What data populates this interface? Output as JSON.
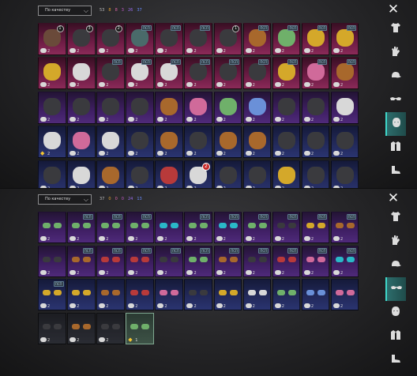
{
  "panels": [
    {
      "sort_label": "По качеству",
      "counts": [
        {
          "value": "53",
          "color": "#bdbdbd"
        },
        {
          "value": "8",
          "color": "#e0a030"
        },
        {
          "value": "8",
          "color": "#e066a8"
        },
        {
          "value": "3",
          "color": "#c45ac8"
        },
        {
          "value": "26",
          "color": "#9b6cf0"
        },
        {
          "value": "37",
          "color": "#6a8cff"
        }
      ],
      "active_tab": 4,
      "rows": [
        [
          "p:2:b:1:s",
          "p:2:b:3:d",
          "p:2:b:2:d",
          "p:2:t:ПСП:t",
          "p:2:t:ПСП:d",
          "p:2:t:ПСП:d",
          "p:2:b:1:d",
          "p:2:t:ПСП:o",
          "p:2:t:ПСП:g",
          "p:2:t:ПСП:y",
          "p:2:t:ПСП:y"
        ],
        [
          "p:2:n::y",
          "p:2:n::w",
          "p:2:t:ПСП:d",
          "p:2:t:ПСП:w",
          "p:2:t:ПСП:w",
          "p:2:t:ПСП:d",
          "p:2:t:ПСП:d",
          "p:2:t:ПСП:d",
          "p:2:t:ПСП:y",
          "p:2:t:ПСП:p",
          "p:2:t:ПСП:o"
        ],
        [
          "u:2:n::d",
          "u:2:n::d",
          "u:2:n::d",
          "u:2:n::d",
          "u:2:n::o",
          "u:2:n::p",
          "u:2:n::g",
          "u:2:n::b",
          "u:2:n::d",
          "u:2:n::d",
          "u:2:n::w"
        ],
        [
          "b:2:n::w:star",
          "b:2:n::p",
          "b:2:n::w",
          "b:2:n::d",
          "b:2:n::o",
          "b:2:n::d",
          "b:2:n::o",
          "b:2:n::o",
          "b:2:n::d",
          "b:2:n::d",
          "b:2:n::d"
        ],
        [
          "b:2:n::d",
          "b:2:n::w",
          "b:2:n::o",
          "b:2:n::d",
          "b:2:n::r",
          "b:2:r:2:w",
          "b:2:n::d",
          "b:2:n::d",
          "b:2:n::y",
          "b:2:n::d",
          "b:2:n::d"
        ]
      ]
    },
    {
      "sort_label": "По качеству",
      "counts": [
        {
          "value": "37",
          "color": "#bdbdbd"
        },
        {
          "value": "0",
          "color": "#e0a030"
        },
        {
          "value": "0",
          "color": "#e066a8"
        },
        {
          "value": "0",
          "color": "#c45ac8"
        },
        {
          "value": "24",
          "color": "#9b6cf0"
        },
        {
          "value": "13",
          "color": "#6a8cff"
        }
      ],
      "active_tab": 3,
      "rows": [
        [
          "u:2:n::g",
          "u:2:t:ПСП:g",
          "u:2:t:ПСП:g",
          "u:2:t:ПСП:g",
          "u:2:n::c",
          "u:2:t:ПСП:g",
          "u:2:t:ПСП:c",
          "u:2:t:ПСП:g",
          "u:2:t:ПСП:d",
          "u:2:t:ПСП:y",
          "u:2:t:ПСП:o"
        ],
        [
          "u:2:n::d",
          "u:2:t:ПСП:o",
          "u:2:t:ПСП:r",
          "u:2:t:ПСП:r",
          "u:2:t:ПСП:d",
          "u:2:t:ПСП:g",
          "u:2:t:ПСП:o",
          "u:2:t:ПСП:d",
          "u:2:t:ПСП:r",
          "u:2:t:ПСП:p",
          "u:2:t:ПСП:c"
        ],
        [
          "b:2:t:ПСП:y",
          "b:2:n::y",
          "b:2:n::o",
          "b:2:n::r",
          "b:2:n::p",
          "b:2:n::d",
          "b:2:n::y",
          "b:2:n::w",
          "b:2:n::g",
          "b:2:n::b",
          "b:2:n::p"
        ],
        [
          "d:2:n::d",
          "d:2:n::o",
          "d:2:n::d",
          "g:1:n::g:star"
        ]
      ]
    }
  ],
  "tab_icons": [
    "tshirt-icon",
    "glove-icon",
    "cap-icon",
    "glasses-icon",
    "mask-icon",
    "jacket-icon",
    "shoe-icon"
  ],
  "close_label": "✕"
}
